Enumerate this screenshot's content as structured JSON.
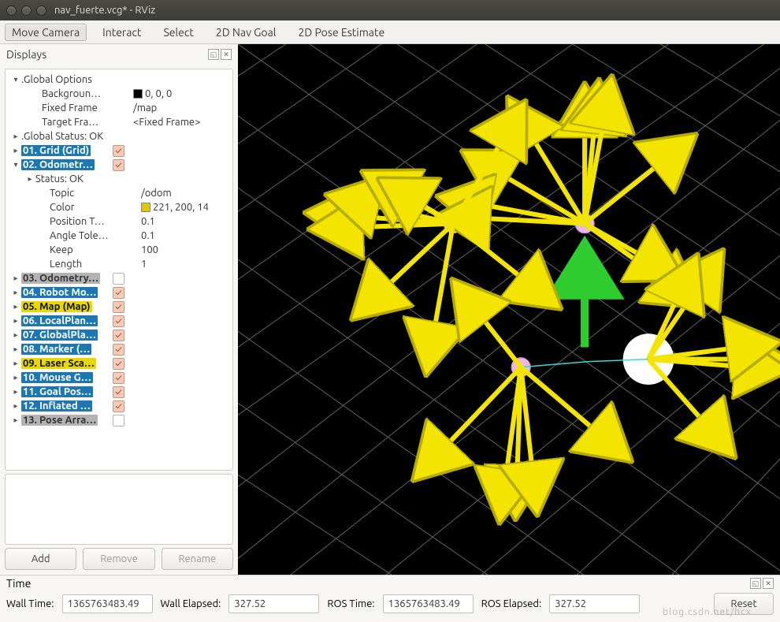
{
  "window": {
    "title": "nav_fuerte.vcg* - RViz"
  },
  "toolbar": {
    "items": [
      "Move Camera",
      "Interact",
      "Select",
      "2D Nav Goal",
      "2D Pose Estimate"
    ],
    "active_index": 0
  },
  "displays": {
    "title": "Displays",
    "global_options": {
      "label": ".Global Options",
      "background": {
        "label": "Backgroun…",
        "value": "0, 0, 0",
        "swatch": "#000000"
      },
      "fixed_frame": {
        "label": "Fixed Frame",
        "value": "/map"
      },
      "target_frame": {
        "label": "Target Fra…",
        "value": "<Fixed Frame>"
      }
    },
    "global_status": {
      "label": ".Global Status: OK"
    },
    "odometry_expanded": {
      "status": "Status: OK",
      "topic_label": "Topic",
      "topic_value": "/odom",
      "color_label": "Color",
      "color_value": "221, 200, 14",
      "color_swatch": "#ddc80e",
      "position_label": "Position T…",
      "position_value": "0.1",
      "angle_label": "Angle Tole…",
      "angle_value": "0.1",
      "keep_label": "Keep",
      "keep_value": "100",
      "length_label": "Length",
      "length_value": "1"
    },
    "items": [
      {
        "label": "01. Grid (Grid)",
        "color": "blue",
        "checked": true
      },
      {
        "label": "02. Odometr…",
        "color": "blue",
        "checked": true,
        "expanded": true
      },
      {
        "label": "03. Odometry…",
        "color": "grey",
        "checked": false
      },
      {
        "label": "04. Robot Mo…",
        "color": "blue",
        "checked": true
      },
      {
        "label": "05. Map (Map)",
        "color": "yellow",
        "checked": true
      },
      {
        "label": "06. LocalPlan…",
        "color": "blue",
        "checked": true
      },
      {
        "label": "07. GlobalPla…",
        "color": "blue",
        "checked": true
      },
      {
        "label": "08. Marker (…",
        "color": "blue",
        "checked": true
      },
      {
        "label": "09. Laser Sca…",
        "color": "yellow",
        "checked": true
      },
      {
        "label": "10. Mouse G…",
        "color": "blue",
        "checked": true
      },
      {
        "label": "11. Goal Pos…",
        "color": "blue",
        "checked": true
      },
      {
        "label": "12. Inflated …",
        "color": "blue",
        "checked": true
      },
      {
        "label": "13. Pose Arra…",
        "color": "grey",
        "checked": false
      }
    ],
    "buttons": {
      "add": "Add",
      "remove": "Remove",
      "rename": "Rename"
    }
  },
  "time": {
    "title": "Time",
    "wall_time_label": "Wall Time:",
    "wall_time": "1365763483.49",
    "wall_elapsed_label": "Wall Elapsed:",
    "wall_elapsed": "327.52",
    "ros_time_label": "ROS Time:",
    "ros_time": "1365763483.49",
    "ros_elapsed_label": "ROS Elapsed:",
    "ros_elapsed": "327.52",
    "reset": "Reset"
  },
  "watermark": "blog.csdn.net/hcx"
}
